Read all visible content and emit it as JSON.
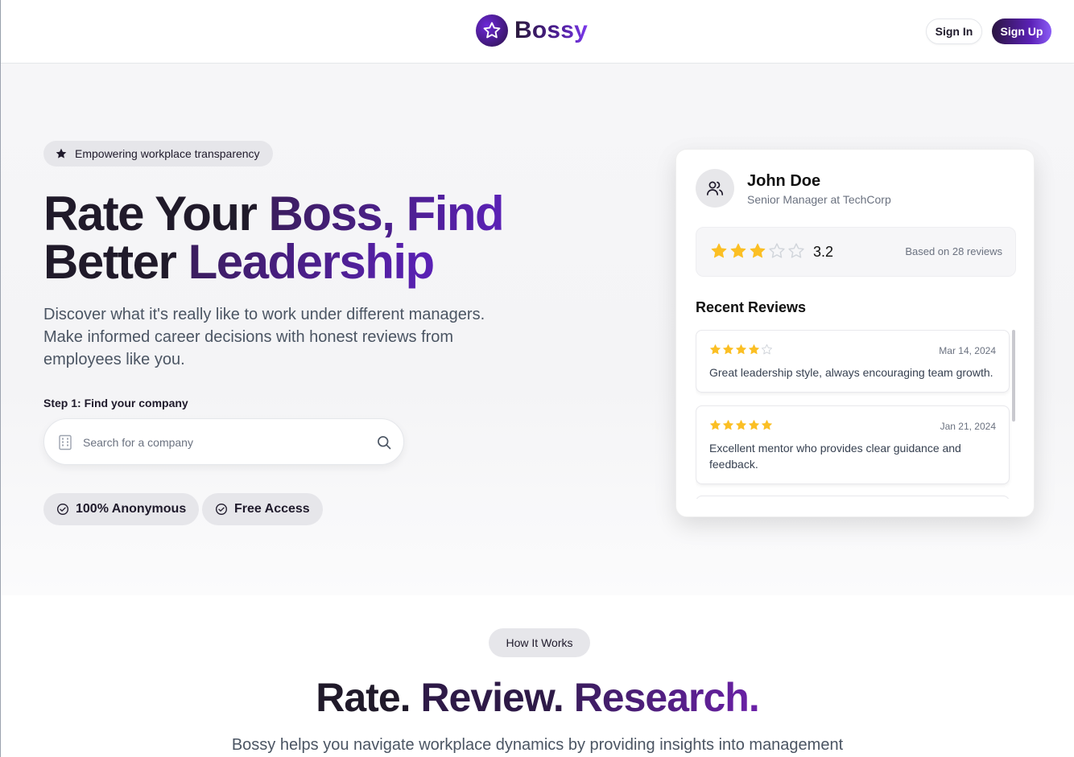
{
  "header": {
    "brand": "Bossy",
    "sign_in": "Sign In",
    "sign_up": "Sign Up"
  },
  "hero": {
    "tag": "Empowering workplace transparency",
    "headline": {
      "part1": "Rate Your ",
      "part2": "Boss, Find",
      "part3": "Better ",
      "part4": "Leadership"
    },
    "subtext": "Discover what it's really like to work under different managers. Make informed career decisions with honest reviews from employees like you.",
    "step_label": "Step 1: Find your company",
    "search_placeholder": "Search for a company",
    "badges": [
      "100% Anonymous",
      "Free Access"
    ]
  },
  "card": {
    "name": "John Doe",
    "role": "Senior Manager at TechCorp",
    "rating": "3.2",
    "rating_fill": 3,
    "rating_count": "Based on 28 reviews",
    "recent_title": "Recent Reviews",
    "reviews": [
      {
        "stars": 4,
        "date": "Mar 14, 2024",
        "text": "Great leadership style, always encouraging team growth."
      },
      {
        "stars": 5,
        "date": "Jan 21, 2024",
        "text": "Excellent mentor who provides clear guidance and feedback."
      }
    ]
  },
  "how": {
    "pill": "How It Works",
    "title": {
      "w1": "Rate. ",
      "w2": "Review. ",
      "w3": "Research."
    },
    "sub": "Bossy helps you navigate workplace dynamics by providing insights into management"
  },
  "colors": {
    "accent": "#5b21b6",
    "star": "#fbbf24",
    "star_empty": "#d1d5db"
  }
}
